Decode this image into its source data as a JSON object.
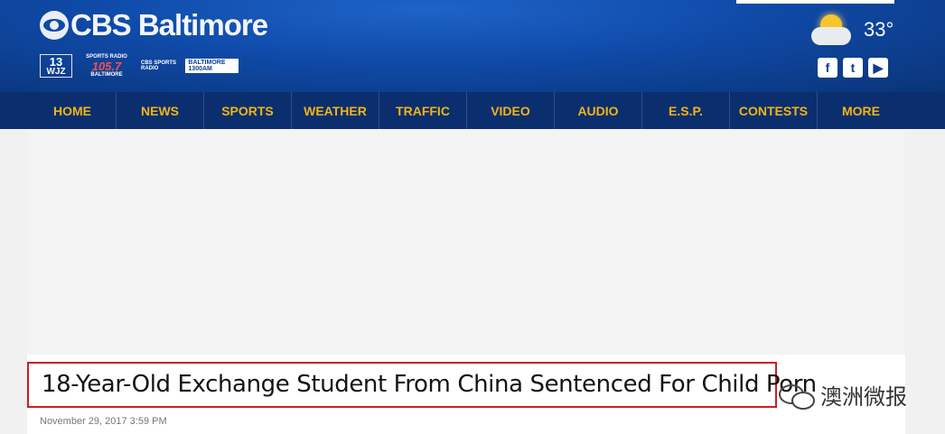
{
  "header": {
    "brand": "CBS Baltimore",
    "sub_logos": {
      "wjz": {
        "num": "13",
        "label": "WJZ"
      },
      "fan": {
        "top": "SPORTS RADIO",
        "num": "105.7",
        "fm": "THE FAN",
        "bottom": "BALTIMORE"
      },
      "cbs_sports": {
        "label": "CBS SPORTS RADIO",
        "box": "BALTIMORE 1300AM"
      }
    },
    "weather": {
      "temp": "33°",
      "icon": "partly-sunny-icon"
    },
    "social": [
      {
        "name": "facebook-icon",
        "glyph": "f"
      },
      {
        "name": "twitter-icon",
        "glyph": "t"
      },
      {
        "name": "youtube-icon",
        "glyph": "▶"
      }
    ]
  },
  "nav": {
    "items": [
      "HOME",
      "NEWS",
      "SPORTS",
      "WEATHER",
      "TRAFFIC",
      "VIDEO",
      "AUDIO",
      "E.S.P.",
      "CONTESTS",
      "MORE"
    ]
  },
  "article": {
    "headline": "18-Year-Old Exchange Student From China Sentenced For Child Porn",
    "date": "November 29, 2017 3:59 PM"
  },
  "watermark": {
    "text": "澳洲微报"
  },
  "colors": {
    "header_blue": "#0f4aa8",
    "nav_bg": "#0b2f6e",
    "nav_text": "#f3b416",
    "highlight_border": "#cc1f1f"
  }
}
